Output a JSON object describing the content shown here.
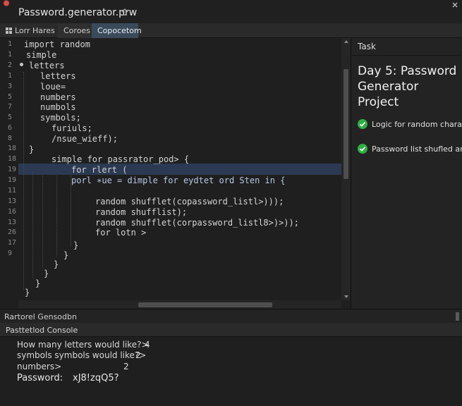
{
  "window": {
    "title": "Password.generator.prw"
  },
  "tabs": [
    {
      "label": "Lorr Hares"
    },
    {
      "label": "Coroes"
    },
    {
      "label": "Copocetom"
    }
  ],
  "editor": {
    "lines": [
      {
        "num": "1",
        "text": "import random"
      },
      {
        "num": "1",
        "text": "simple"
      },
      {
        "num": "2",
        "text": "letters"
      },
      {
        "num": "1",
        "text": "letters"
      },
      {
        "num": "3",
        "text": "loue="
      },
      {
        "num": "5",
        "text": "numbers"
      },
      {
        "num": "7",
        "text": "numbols"
      },
      {
        "num": "5",
        "text": "symbols;"
      },
      {
        "num": "6",
        "text": "furiuls;"
      },
      {
        "num": "8",
        "text": "/nsue_wieff);"
      },
      {
        "num": "18",
        "text": "}"
      },
      {
        "num": "18",
        "text": "simple for passrator_pod> {"
      },
      {
        "num": "19",
        "text": "for rlert ("
      },
      {
        "num": "19",
        "text": "porl ∗ue = dimple for eydtet ord Sten in  {"
      },
      {
        "num": "11",
        "text": ""
      },
      {
        "num": "13",
        "text": "random shufflet(copassword_listl>)));"
      },
      {
        "num": "16",
        "text": "random shufflist);"
      },
      {
        "num": "13",
        "text": "random shufflet(corpassword_listl8>)>));"
      },
      {
        "num": "26",
        "text": "for lotn  >"
      },
      {
        "num": "17",
        "text": "}"
      },
      {
        "num": "9",
        "text": "}"
      },
      {
        "num": "",
        "text": "}"
      },
      {
        "num": "",
        "text": "}"
      },
      {
        "num": "",
        "text": "}"
      }
    ]
  },
  "task_panel": {
    "header": "Task",
    "title": "Day 5: Password Generator Project",
    "items": [
      {
        "label": "Logic for random characte"
      },
      {
        "label": "Password list shufled and"
      }
    ]
  },
  "bottom_panel": {
    "label": "Rartorel Gensodbn"
  },
  "console": {
    "tab_label": "Pasttetlod Console",
    "lines": [
      {
        "prompt": "How many letters would like?>",
        "value": "4"
      },
      {
        "prompt": "symbols symbols would like?>",
        "value": "2"
      },
      {
        "prompt": "numbers>",
        "value": "2"
      }
    ],
    "password_label": "Password:",
    "password_value": "xJ8!zqQ5?"
  }
}
